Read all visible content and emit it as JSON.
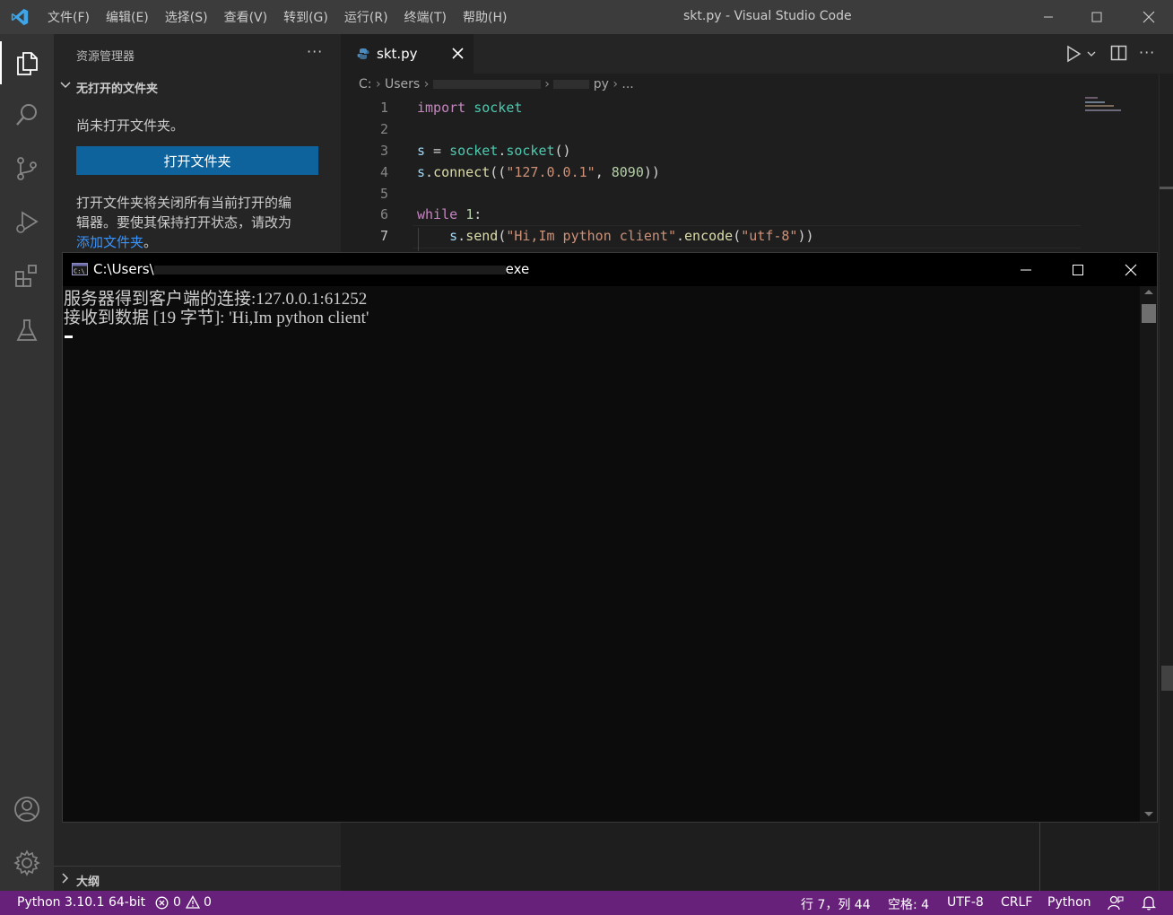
{
  "window": {
    "title": "skt.py - Visual Studio Code",
    "menu": [
      "文件(F)",
      "编辑(E)",
      "选择(S)",
      "查看(V)",
      "转到(G)",
      "运行(R)",
      "终端(T)",
      "帮助(H)"
    ]
  },
  "sidebar": {
    "header": "资源管理器",
    "section_title": "无打开的文件夹",
    "empty_message": "尚未打开文件夹。",
    "open_folder_button": "打开文件夹",
    "description_line1": "打开文件夹将关闭所有当前打开的编",
    "description_line2": "辑器。要使其保持打开状态，请改为",
    "add_folder_link": "添加文件夹",
    "description_end": "。",
    "outline_title": "大纲"
  },
  "editor": {
    "tab_label": "skt.py",
    "breadcrumb": {
      "drive": "C:",
      "users": "Users",
      "file_suffix": "py",
      "ellipsis": "..."
    },
    "line_numbers": [
      "1",
      "2",
      "3",
      "4",
      "5",
      "6",
      "7"
    ],
    "code": {
      "l1_kw": "import",
      "l1_mod": "socket",
      "l3_var": "s",
      "l3_eq": " = ",
      "l3_mod": "socket",
      "l3_dot": ".",
      "l3_fn": "socket",
      "l3_paren": "()",
      "l4_var": "s",
      "l4_dot": ".",
      "l4_fn": "connect",
      "l4_open": "((",
      "l4_str": "\"127.0.0.1\"",
      "l4_comma": ", ",
      "l4_num": "8090",
      "l4_close": "))",
      "l6_kw": "while",
      "l6_num": "1",
      "l6_colon": ":",
      "l7_indent": "    ",
      "l7_var": "s",
      "l7_dot": ".",
      "l7_fn": "send",
      "l7_open": "(",
      "l7_str": "\"Hi,Im python client\"",
      "l7_dot2": ".",
      "l7_fn2": "encode",
      "l7_open2": "(",
      "l7_str2": "\"utf-8\"",
      "l7_close": "))"
    }
  },
  "console": {
    "title_prefix": "C:\\Users\\",
    "title_suffix": "exe",
    "line1": "服务器得到客户端的连接:127.0.0.1:61252",
    "line2": "接收到数据 [19 字节]: 'Hi,Im python client'"
  },
  "statusbar": {
    "interpreter": "Python 3.10.1 64-bit",
    "errors": "0",
    "warnings": "0",
    "position": "行 7，列 44",
    "spaces": "空格: 4",
    "encoding": "UTF-8",
    "eol": "CRLF",
    "language": "Python"
  },
  "colors": {
    "accent_blue": "#0e639c",
    "status_purple": "#68217a",
    "link": "#3794ff"
  },
  "icons": [
    "vscode-logo-icon",
    "explorer-icon",
    "search-icon",
    "source-control-icon",
    "run-debug-icon",
    "extensions-icon",
    "testing-icon",
    "account-icon",
    "manage-gear-icon",
    "python-file-icon",
    "close-icon",
    "run-icon",
    "split-editor-icon",
    "more-actions-icon",
    "console-icon",
    "error-icon",
    "warning-icon",
    "feedback-icon",
    "bell-icon"
  ]
}
